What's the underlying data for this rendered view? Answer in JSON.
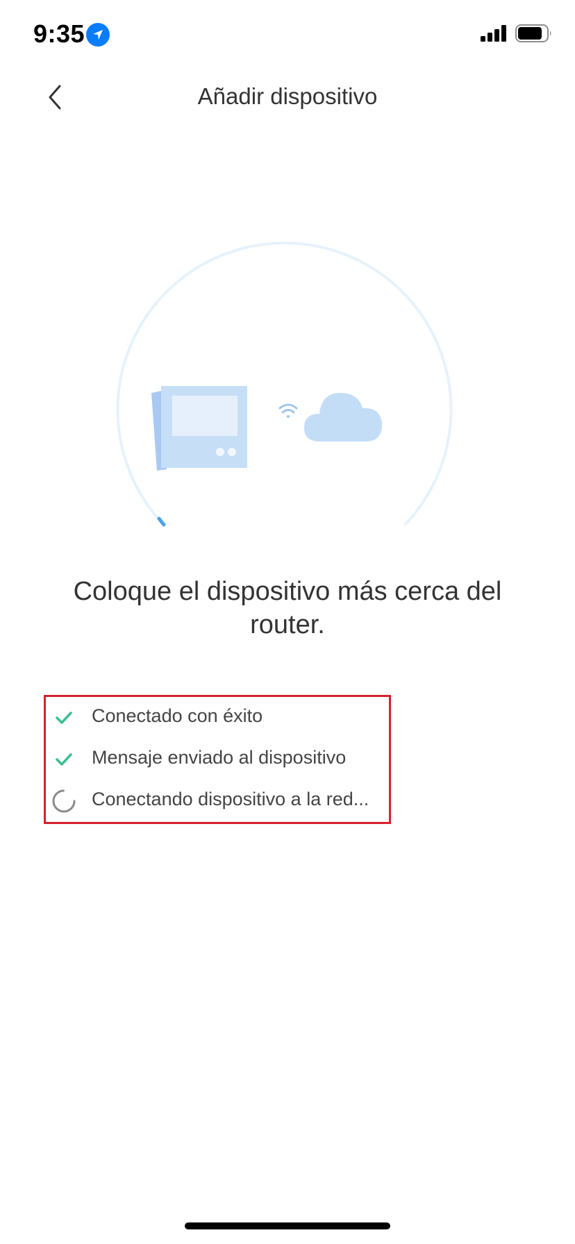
{
  "status_bar": {
    "time": "9:35",
    "location_icon": "location-arrow-icon",
    "signal_icon": "cellular-signal-icon",
    "battery_icon": "battery-icon"
  },
  "nav": {
    "back_icon": "chevron-left-icon",
    "title": "Añadir dispositivo"
  },
  "illustration": {
    "device_icon": "thermostat-device-icon",
    "wifi_icon": "wifi-icon",
    "cloud_icon": "cloud-icon",
    "progress_ring_color": "#e3f1fc",
    "progress_indicator_color": "#4aa3e8"
  },
  "message": "Coloque el dispositivo más cerca del router.",
  "steps": [
    {
      "icon": "check-icon",
      "label": "Conectado con éxito",
      "state": "done"
    },
    {
      "icon": "check-icon",
      "label": "Mensaje enviado al dispositivo",
      "state": "done"
    },
    {
      "icon": "spinner-icon",
      "label": "Conectando dispositivo a la red...",
      "state": "in-progress"
    }
  ],
  "colors": {
    "check": "#3cbf8f",
    "highlight_border": "#d8202f",
    "illustration_blue": "#c3ddf7"
  }
}
